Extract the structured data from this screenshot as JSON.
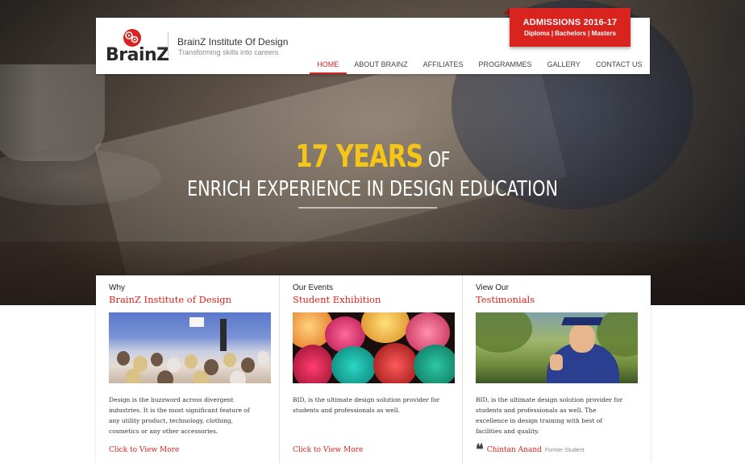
{
  "header": {
    "logo_text": "BrainZ",
    "institute_name": "BrainZ Institute Of Design",
    "tagline": "Transforming skills into careers",
    "nav": [
      {
        "label": "HOME",
        "active": true
      },
      {
        "label": "ABOUT BRAINZ",
        "active": false
      },
      {
        "label": "AFFILIATES",
        "active": false
      },
      {
        "label": "PROGRAMMES",
        "active": false
      },
      {
        "label": "GALLERY",
        "active": false
      },
      {
        "label": "CONTACT US",
        "active": false
      }
    ],
    "admissions": {
      "title": "ADMISSIONS 2016-17",
      "subtitle": "Diploma | Bachelors | Masters"
    }
  },
  "hero": {
    "highlight": "17 YEARS",
    "of": "OF",
    "line2": "ENRICH EXPERIENCE IN DESIGN EDUCATION"
  },
  "columns": [
    {
      "kicker": "Why",
      "title": "BrainZ Institute of Design",
      "text": "Design is the buzzword across divergent industries. It is the most significant feature of any utility product, technology, clothing, cosmetics or any other accessories.",
      "more": "Click to View More"
    },
    {
      "kicker": "Our Events",
      "title": "Student Exhibition",
      "text": "BID, is the ultimate design solution provider for students and professionals as well.",
      "more": "Click to View More"
    },
    {
      "kicker": "View Our",
      "title": "Testimonials",
      "text": "BID, is the ultimate design solution provider for students and professionals as well. The excellence in design training with best of facilities and quality.",
      "quote_name": "Chintan Anand",
      "quote_role": "Former Student"
    }
  ],
  "colors": {
    "accent": "#d9231e",
    "highlight": "#f5c518"
  }
}
